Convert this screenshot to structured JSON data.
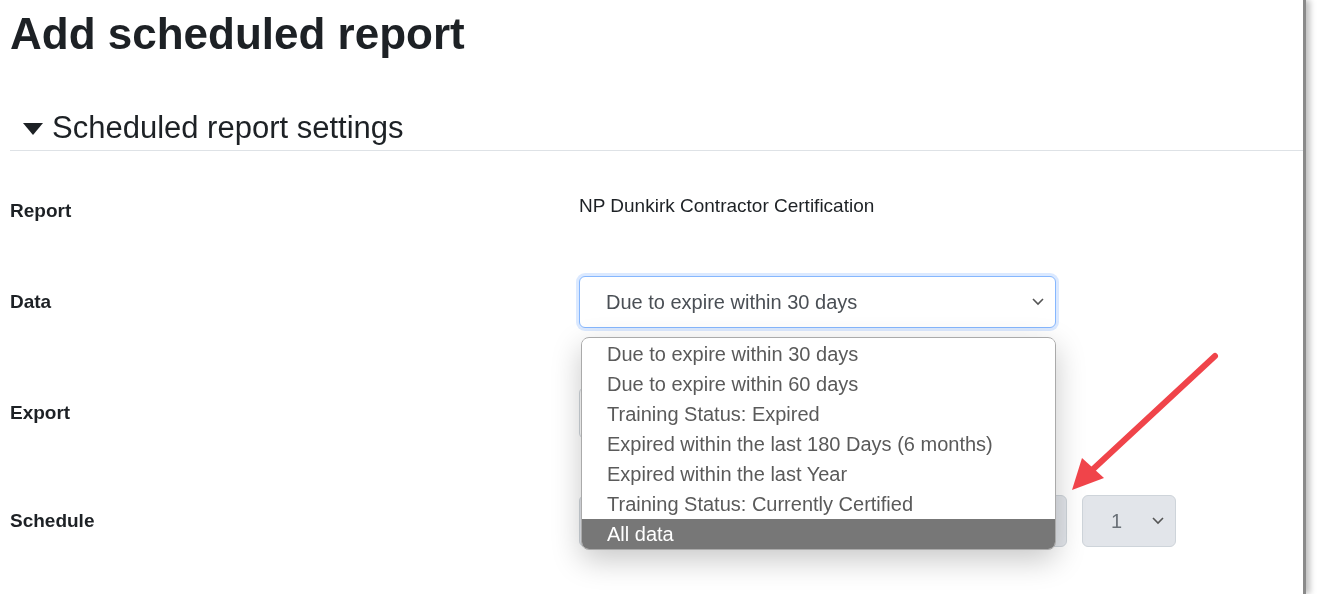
{
  "page": {
    "title": "Add scheduled report"
  },
  "section": {
    "title": "Scheduled report settings",
    "expanded": true
  },
  "form": {
    "report": {
      "label": "Report",
      "value": "NP Dunkirk Contractor Certification"
    },
    "data": {
      "label": "Data",
      "value": "Due to expire within 30 days",
      "focused": true
    },
    "export": {
      "label": "Export"
    },
    "schedule": {
      "label": "Schedule",
      "selects": [
        {
          "value": "1",
          "disabled": true
        }
      ]
    }
  },
  "dropdown": {
    "options": [
      {
        "label": "Due to expire within 30 days",
        "selected": false
      },
      {
        "label": "Due to expire within 60 days",
        "selected": false
      },
      {
        "label": "Training Status: Expired",
        "selected": false
      },
      {
        "label": "Expired within the last 180 Days (6 months)",
        "selected": false
      },
      {
        "label": "Expired within the last Year",
        "selected": false
      },
      {
        "label": "Training Status: Currently Certified",
        "selected": false
      },
      {
        "label": "All data",
        "selected": true
      }
    ]
  }
}
